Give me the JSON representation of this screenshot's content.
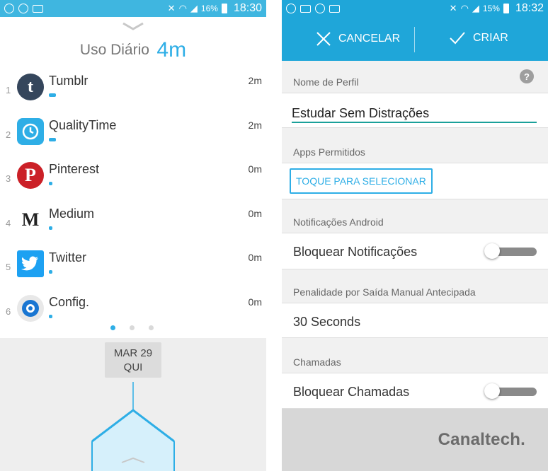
{
  "left": {
    "statusbar": {
      "battery": "16%",
      "time": "18:30"
    },
    "daily_usage": {
      "label": "Uso Diário",
      "value": "4m"
    },
    "apps": [
      {
        "rank": "1",
        "name": "Tumblr",
        "time": "2m",
        "icon": "tumblr-icon",
        "color": "#35465c"
      },
      {
        "rank": "2",
        "name": "QualityTime",
        "time": "2m",
        "icon": "qualitytime-icon",
        "color": "#2eaee6"
      },
      {
        "rank": "3",
        "name": "Pinterest",
        "time": "0m",
        "icon": "pinterest-icon",
        "color": "#cb2027"
      },
      {
        "rank": "4",
        "name": "Medium",
        "time": "0m",
        "icon": "medium-icon",
        "color": "#222222"
      },
      {
        "rank": "5",
        "name": "Twitter",
        "time": "0m",
        "icon": "twitter-icon",
        "color": "#1da1f2"
      },
      {
        "rank": "6",
        "name": "Config.",
        "time": "0m",
        "icon": "settings-gear-icon",
        "color": "#1976d2"
      }
    ],
    "date": {
      "line1": "MAR 29",
      "line2": "QUI"
    }
  },
  "right": {
    "statusbar": {
      "battery": "15%",
      "time": "18:32"
    },
    "toolbar": {
      "cancel_label": "CANCELAR",
      "create_label": "CRIAR"
    },
    "profile": {
      "header": "Nome de Perfil",
      "value": "Estudar Sem Distrações"
    },
    "apps_allowed": {
      "header": "Apps Permitidos",
      "button": "TOQUE PARA SELECIONAR"
    },
    "notifications": {
      "header": "Notificações Android",
      "label": "Bloquear Notificações"
    },
    "penalty": {
      "header": "Penalidade por Saída Manual Antecipada",
      "value": "30 Seconds"
    },
    "calls": {
      "header": "Chamadas",
      "label": "Bloquear Chamadas"
    },
    "watermark": "Canaltech."
  },
  "colors": {
    "accent": "#2eaee6",
    "toolbar": "#1fa6d9",
    "underline": "#1aa09a"
  }
}
